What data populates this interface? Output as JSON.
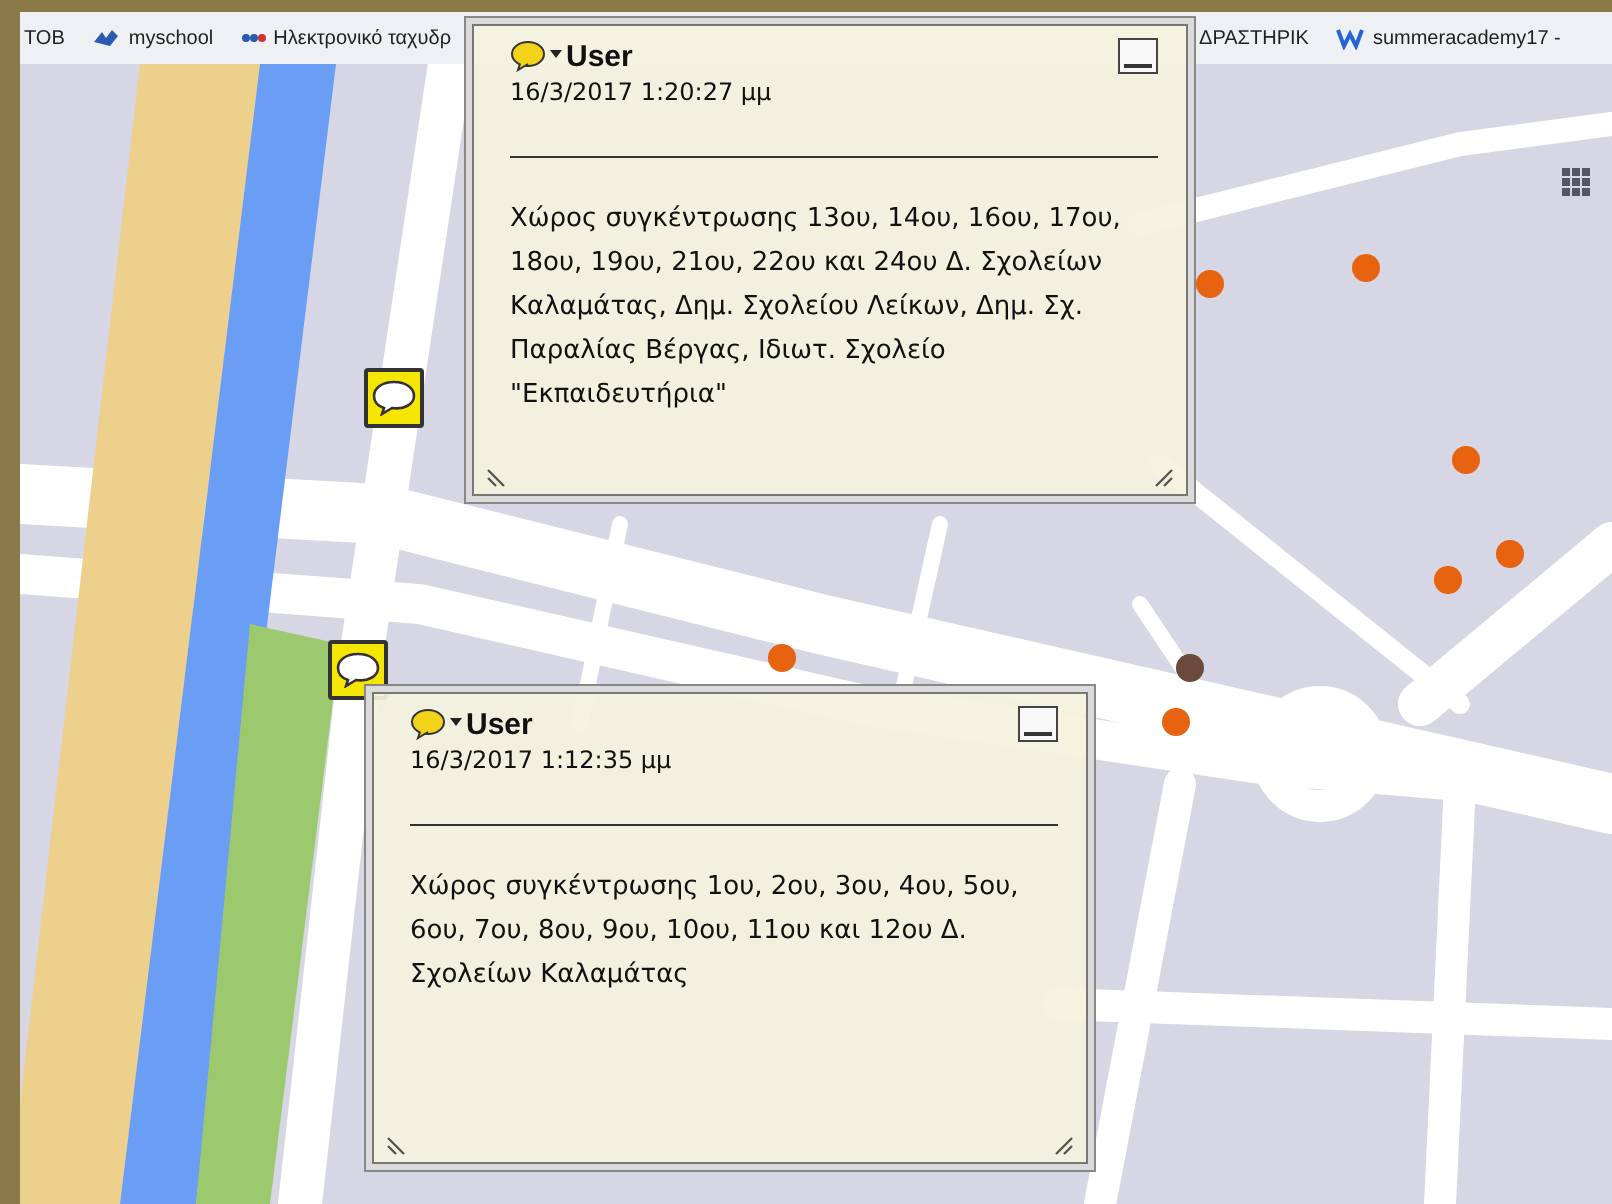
{
  "bookmarks": [
    {
      "label": "ΤΟΒ",
      "kind": "plain"
    },
    {
      "label": "myschool",
      "kind": "bird"
    },
    {
      "label": "Ηλεκτρονικό ταχυδρ",
      "kind": "dots"
    },
    {
      "label": "ΔΡΑΣΤΗΡΙΚ",
      "kind": "plain"
    },
    {
      "label": "summeracademy17 -",
      "kind": "w"
    }
  ],
  "notes": [
    {
      "author": "User",
      "date": "16/3/2017 1:20:27 μμ",
      "text": "Χώρος συγκέντρωσης 13ου, 14ου, 16ου, 17ου, 18ου, 19ου, 21ου, 22ου και 24ου Δ. Σχολείων Καλαμάτας, Δημ. Σχολείου Λείκων, Δημ. Σχ. Παραλίας Βέργας, Ιδιωτ. Σχολείο \"Εκπαιδευτήρια\""
    },
    {
      "author": "User",
      "date": "16/3/2017 1:12:35 μμ",
      "text": "Χώρος συγκέντρωσης 1ου, 2ου, 3ου, 4ου, 5ου, 6ου, 7ου, 8ου, 9ου, 10ου, 11ου και 12ου Δ. Σχολείων Καλαμάτας"
    }
  ]
}
